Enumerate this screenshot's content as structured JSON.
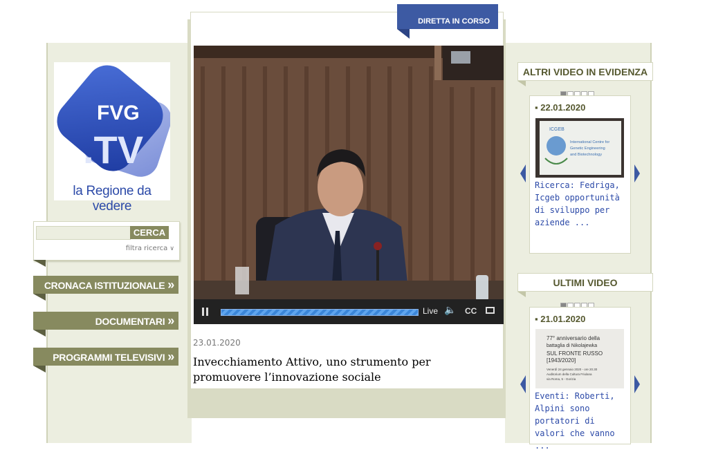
{
  "logo": {
    "tagline": "la Regione da vedere",
    "letters_top": "FVG",
    "letters_bottom": ".TV"
  },
  "search": {
    "button_label": "CERCA",
    "placeholder": "",
    "filter_label": "filtra ricerca",
    "filter_icon": "chevron-double-down-icon"
  },
  "nav": {
    "items": [
      {
        "label": "CRONACA ISTITUZIONALE"
      },
      {
        "label": "DOCUMENTARI"
      },
      {
        "label": "PROGRAMMI TELEVISIVI"
      }
    ]
  },
  "live_tab": {
    "label": "DIRETTA IN CORSO"
  },
  "player": {
    "live_label": "Live",
    "cc_label": "CC"
  },
  "main_video": {
    "date": "23.01.2020",
    "title": "Invecchiamento Attivo, uno strumento per promuovere l’innovazione sociale"
  },
  "featured": {
    "title": "ALTRI VIDEO IN EVIDENZA",
    "card": {
      "date": "22.01.2020",
      "text": "Ricerca: Fedriga, Icgeb opportunità di sviluppo per aziende ..."
    }
  },
  "latest": {
    "title": "ULTIMI VIDEO",
    "card": {
      "date": "21.01.2020",
      "text": "Eventi: Roberti, Alpini sono portatori di valori che vanno ..."
    }
  },
  "thumbs": {
    "icgeb": {
      "line1": "International Centre for",
      "line2": "Genetic Engineering",
      "line3": "and Biotechnology",
      "acronym": "ICGEB"
    },
    "poster": {
      "line1": "77° anniversario della",
      "line2": "battaglia di Nikolajewka",
      "line3": "SUL FRONTE RUSSO",
      "line4": "[1943/2020]",
      "line5": "Venerdì 24 gennaio 2020 - ore 20.30",
      "line6": "Auditorium della Cultura Friulana",
      "line7": "via Roma, 5 - Gorizia"
    }
  },
  "colors": {
    "accent_blue": "#3d5aa3",
    "olive": "#878a5f",
    "link_blue": "#2c4aa8"
  }
}
